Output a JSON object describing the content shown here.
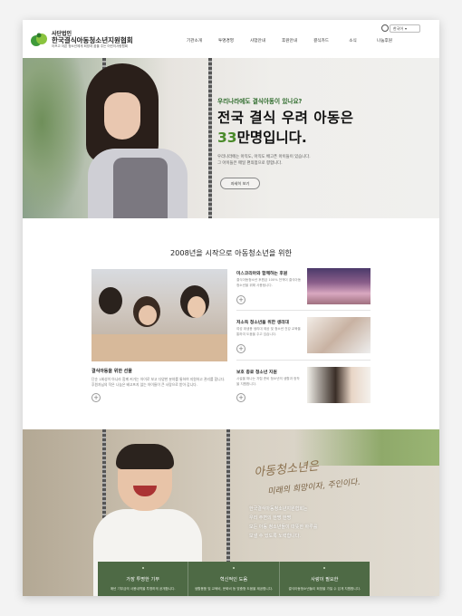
{
  "header": {
    "org_sub": "사단법인",
    "org_name": "한국결식아동청소년지원협회",
    "org_tagline": "아프고 아픈 청소년에게 희망과 꿈을 주는 어린이사랑협회",
    "lang": "한국어",
    "nav": [
      "기관소개",
      "투명경영",
      "사업안내",
      "후원안내",
      "결식카드",
      "소식",
      "나눔후원"
    ]
  },
  "hero": {
    "sub": "우리나라에도 결식아동이 있나요?",
    "title_line1": "전국 결식 우려 아동은",
    "title_num": "33",
    "title_rest": "만명입니다.",
    "desc_line1": "우리나라에는 아직도, 아직도 배고픈 아이들이 있습니다.",
    "desc_line2": "그 아이들은 매일 편의점으로 향합니다.",
    "button": "자세히 보기"
  },
  "section2": {
    "title": "2008년을 시작으로 아동청소년을 위한",
    "main_caption": "결식아동을 위한 선물",
    "main_desc": "단순 1회성이 아니라 함께 커가는 아이로 보고 다양한 분야를 통하여 지원하고 관리를 합니다. 후원자님의 작은 나눔은 배고프지 않는 아이들이 큰 사랑으로 받아 갑니다.",
    "items": [
      {
        "title": "미스코리아와 함께하는 후원",
        "desc": "결식아동청소년 후원금 100% 전액이 결식아동청소년을 위해 사용됩니다."
      },
      {
        "title": "저소득 청소년을 위한 생리대",
        "desc": "여성 위생용 생리대 제공 및 청소년 건강 교육을 통하여 도움을 주고 있습니다."
      },
      {
        "title": "보호 종료 청소년 지원",
        "desc": "시설을 떠나는 자립 준비 청소년의 생활과 정착을 지원합니다."
      }
    ]
  },
  "bottom": {
    "callig1": "아동청소년은",
    "callig2": "미래의 희망이자, 주인이다.",
    "text_lines": [
      "한국결식아동청소년지원협회는",
      "우리 주변의 한명 한명",
      "모든 아동 청소년들이 따뜻한 하루를",
      "보낼 수 있도록 노력합니다."
    ],
    "boxes": [
      {
        "title": "가장 투명한 기부",
        "desc": "매년 기부금의 사용내역을 투명하게 공개합니다."
      },
      {
        "title": "혁신적인 도움",
        "desc": "생활용품 및 교육비, 문화비 등 맞춤형 도움을 제공합니다."
      },
      {
        "title": "사랑이 필요한",
        "desc": "결식아동청소년들이 희망을 가질 수 있게 지원합니다."
      }
    ]
  }
}
